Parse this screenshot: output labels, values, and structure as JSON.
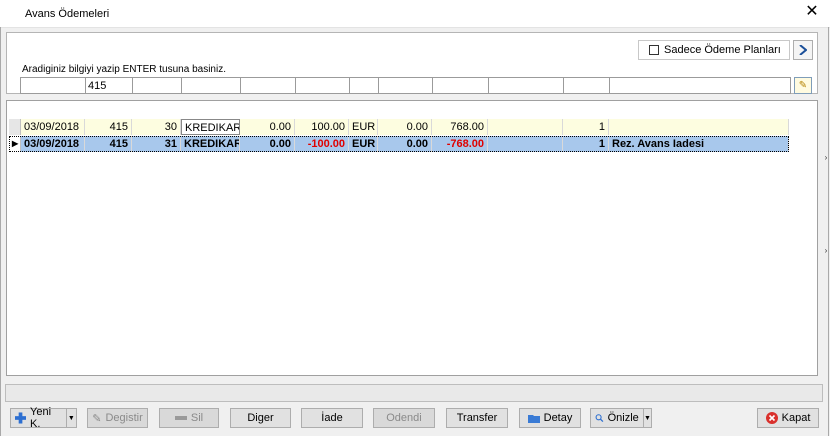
{
  "window": {
    "title": "Avans Ödemeleri",
    "close_glyph": "✕"
  },
  "search": {
    "checkbox_label": "Sadece Ödeme Planları",
    "hint": "Aradiginiz bilgiyi yazip ENTER tusuna basiniz.",
    "filters": [
      "",
      "415",
      "",
      "",
      "",
      "",
      "",
      "",
      "",
      "",
      "",
      "",
      ""
    ]
  },
  "grid": {
    "rows": [
      {
        "date": "03/09/2018",
        "c1": "415",
        "c2": "30",
        "type": "KREDIKARTI",
        "a1": "0.00",
        "a2": "100.00",
        "currency": "EUR",
        "a3": "0.00",
        "a4": "768.00",
        "c3": "",
        "c4": "1",
        "desc": ""
      },
      {
        "date": "03/09/2018",
        "c1": "415",
        "c2": "31",
        "type": "KREDIKART",
        "a1": "0.00",
        "a2": "-100.00",
        "currency": "EUR",
        "a3": "0.00",
        "a4": "-768.00",
        "c3": "",
        "c4": "1",
        "desc": "Rez. Avans Iadesi"
      }
    ],
    "current_row_marker": "▶"
  },
  "toolbar": {
    "new_label": "Yeni K.",
    "edit_label": "Degistir",
    "delete_label": "Sil",
    "other_label": "Diger",
    "refund_label": "İade",
    "paid_label": "Odendi",
    "transfer_label": "Transfer",
    "detail_label": "Detay",
    "preview_label": "Önizle",
    "close_label": "Kapat"
  },
  "colors": {
    "selected_row": "#a8c8ec",
    "alt_row": "#fdfde0",
    "negative": "#e00000",
    "accent": "#1a4f99"
  }
}
